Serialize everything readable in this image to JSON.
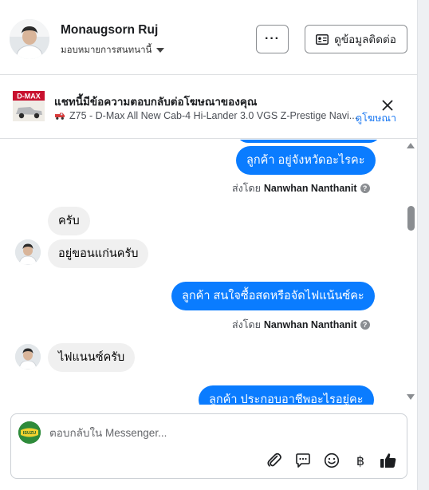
{
  "header": {
    "name": "Monaugsorn Ruj",
    "assignment": "มอบหมายการสนทนานี้",
    "more_label": "···",
    "contact_label": "ดูข้อมูลติดต่อ"
  },
  "ad_banner": {
    "thumb_text": "D-MAX",
    "title": "แชทนี้มีข้อความตอบกลับต่อโฆษณาของคุณ",
    "subtitle": "Z75 - D-Max All New Cab-4 Hi-Lander 3.0 VGS Z-Prestige Navi...",
    "link": "ดูโฆษณา"
  },
  "messages": [
    {
      "from": "page",
      "text": "ลูกค้า  อยู่จังหวัดอะไรคะ"
    },
    {
      "from": "page",
      "sent_by_label": "ส่งโดย",
      "sent_by_name": "Nanwhan Nanthanit"
    },
    {
      "from": "customer",
      "text": "ครับ"
    },
    {
      "from": "customer",
      "text": "อยู่ขอนแก่นครับ"
    },
    {
      "from": "page",
      "text": "ลูกค้า สนใจซื้อสดหรือจัดไฟแน้นซ์คะ"
    },
    {
      "from": "page",
      "sent_by_label": "ส่งโดย",
      "sent_by_name": "Nanwhan Nanthanit"
    },
    {
      "from": "customer",
      "text": "ไฟแนนซ์ครับ"
    },
    {
      "from": "page",
      "text": "ลูกค้า  ประกอบอาชีพอะไรอยู่คะ"
    }
  ],
  "composer": {
    "placeholder": "ตอบกลับใน Messenger...",
    "page_badge_text": "ISUZU",
    "tools": [
      "attachment-icon",
      "saved-replies-icon",
      "emoji-icon",
      "baht-icon",
      "thumbs-up-icon"
    ]
  },
  "colors": {
    "accent": "#0a7cff",
    "link": "#1877f2",
    "incoming_bubble": "#f0f0f0"
  }
}
